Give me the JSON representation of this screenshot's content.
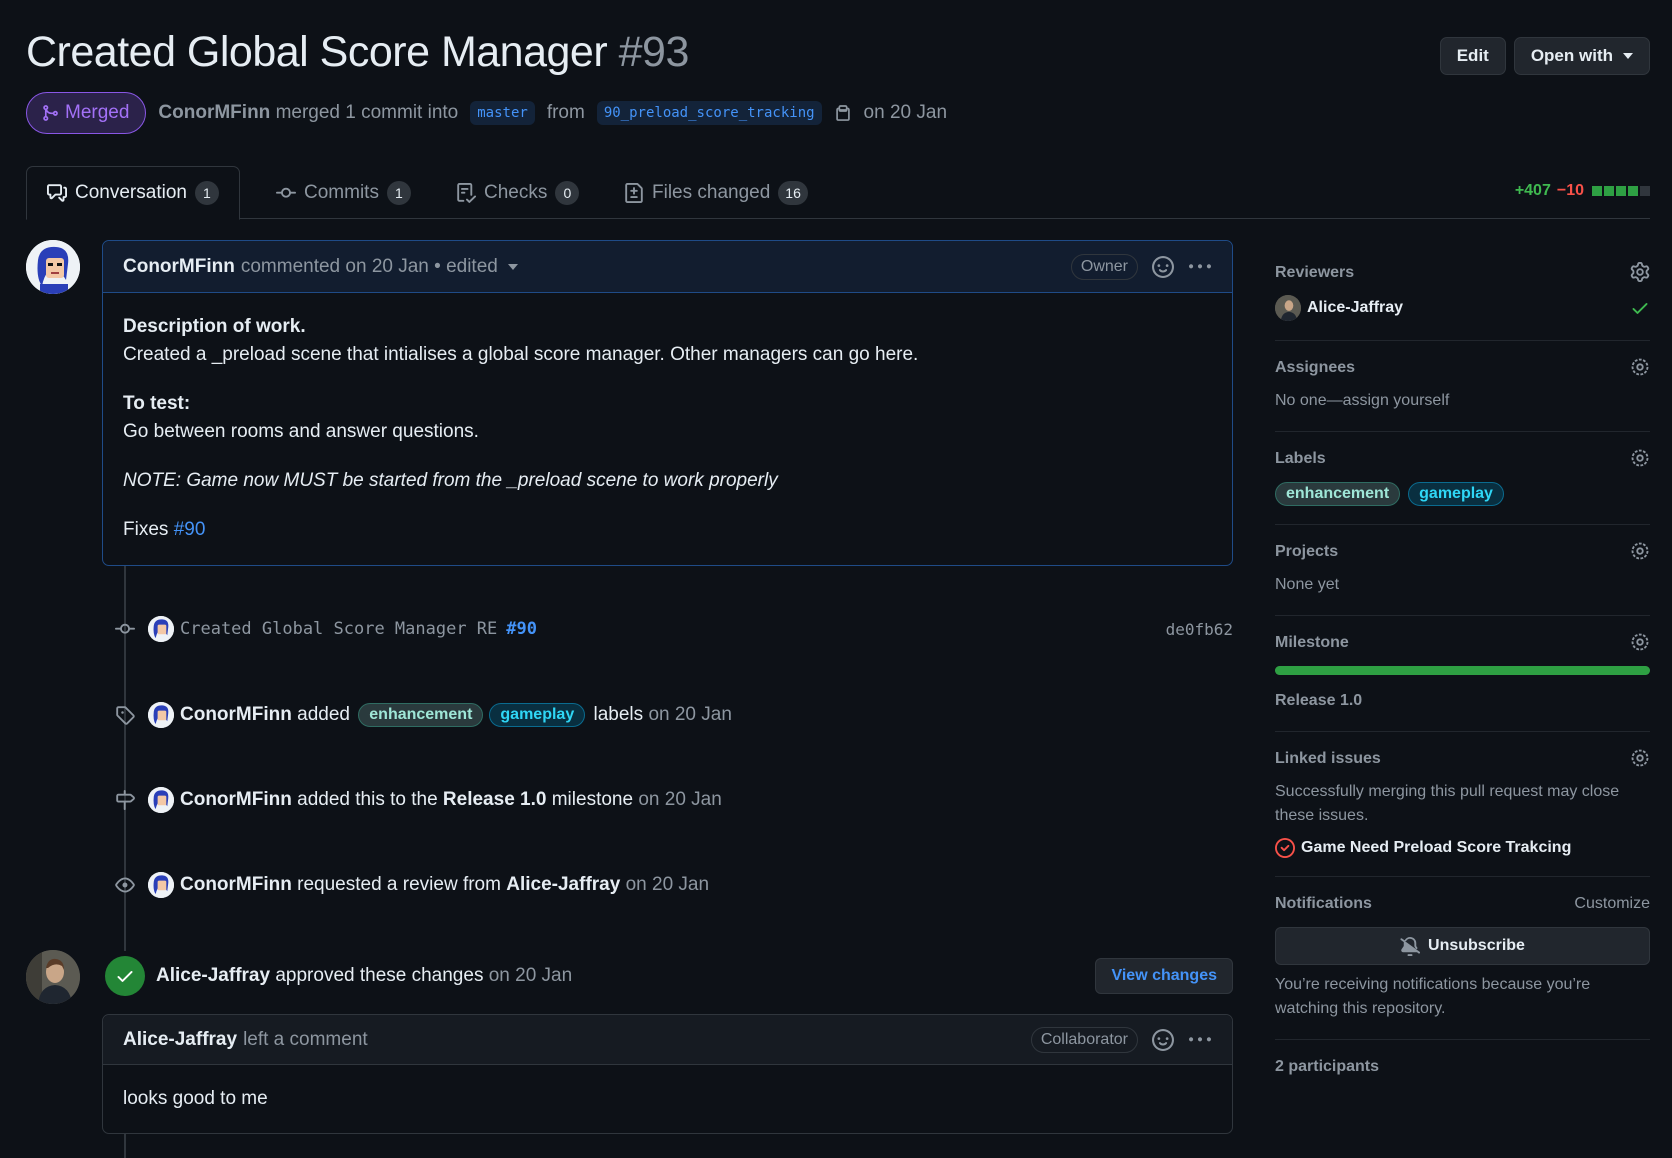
{
  "pr": {
    "title": "Created Global Score Manager",
    "number": "#93",
    "state": "Merged",
    "author": "ConorMFinn",
    "merge_text": "merged 1 commit into",
    "base_branch": "master",
    "from_text": "from",
    "head_branch": "90_preload_score_tracking",
    "date_text": "on 20 Jan"
  },
  "header": {
    "edit_label": "Edit",
    "open_with_label": "Open with"
  },
  "tabs": [
    {
      "label": "Conversation",
      "count": "1",
      "icon": "comment-discussion-icon"
    },
    {
      "label": "Commits",
      "count": "1",
      "icon": "commit-icon"
    },
    {
      "label": "Checks",
      "count": "0",
      "icon": "checklist-icon"
    },
    {
      "label": "Files changed",
      "count": "16",
      "icon": "file-diff-icon"
    }
  ],
  "diffstat": {
    "additions": "+407",
    "deletions": "−10",
    "colors": {
      "add": "#2ea043",
      "del": "#da3633",
      "neutral": "#30363d"
    }
  },
  "comment1": {
    "author": "ConorMFinn",
    "meta": "commented on 20 Jan • edited",
    "role": "Owner",
    "heading1": "Description of work.",
    "line1": "Created a _preload scene that intialises a global score manager. Other managers can go here.",
    "heading2": "To test:",
    "line2": "Go between rooms and answer questions.",
    "note": "NOTE: Game now MUST be started from the _preload scene to work properly",
    "fixes_text": "Fixes",
    "fixes_link": "#90"
  },
  "events": {
    "commit": {
      "message": "Created Global Score Manager RE",
      "issue": "#90",
      "sha": "de0fb62"
    },
    "labels": {
      "actor": "ConorMFinn",
      "verb": "added",
      "label1": "enhancement",
      "label2": "gameplay",
      "suffix": "labels",
      "date": "on 20 Jan"
    },
    "milestone": {
      "actor": "ConorMFinn",
      "verb": "added this to the",
      "milestone": "Release 1.0",
      "suffix": "milestone",
      "date": "on 20 Jan"
    },
    "review_req": {
      "actor": "ConorMFinn",
      "verb": "requested a review from",
      "reviewer": "Alice-Jaffray",
      "date": "on 20 Jan"
    },
    "approval": {
      "actor": "Alice-Jaffray",
      "verb": "approved these changes",
      "date": "on 20 Jan",
      "button": "View changes"
    }
  },
  "comment2": {
    "author": "Alice-Jaffray",
    "meta": "left a comment",
    "role": "Collaborator",
    "body": "looks good to me"
  },
  "sidebar": {
    "reviewers": {
      "title": "Reviewers",
      "name": "Alice-Jaffray"
    },
    "assignees": {
      "title": "Assignees",
      "body": "No one—assign yourself"
    },
    "labels": {
      "title": "Labels",
      "label1": "enhancement",
      "label2": "gameplay"
    },
    "projects": {
      "title": "Projects",
      "body": "None yet"
    },
    "milestone": {
      "title": "Milestone",
      "name": "Release 1.0",
      "progress": 1.0
    },
    "linked": {
      "title": "Linked issues",
      "body": "Successfully merging this pull request may close these issues.",
      "issue": "Game Need Preload Score Trakcing"
    },
    "notifications": {
      "title": "Notifications",
      "customize": "Customize",
      "button": "Unsubscribe",
      "body": "You’re receiving notifications because you’re watching this repository."
    },
    "participants": {
      "title": "2 participants"
    }
  }
}
